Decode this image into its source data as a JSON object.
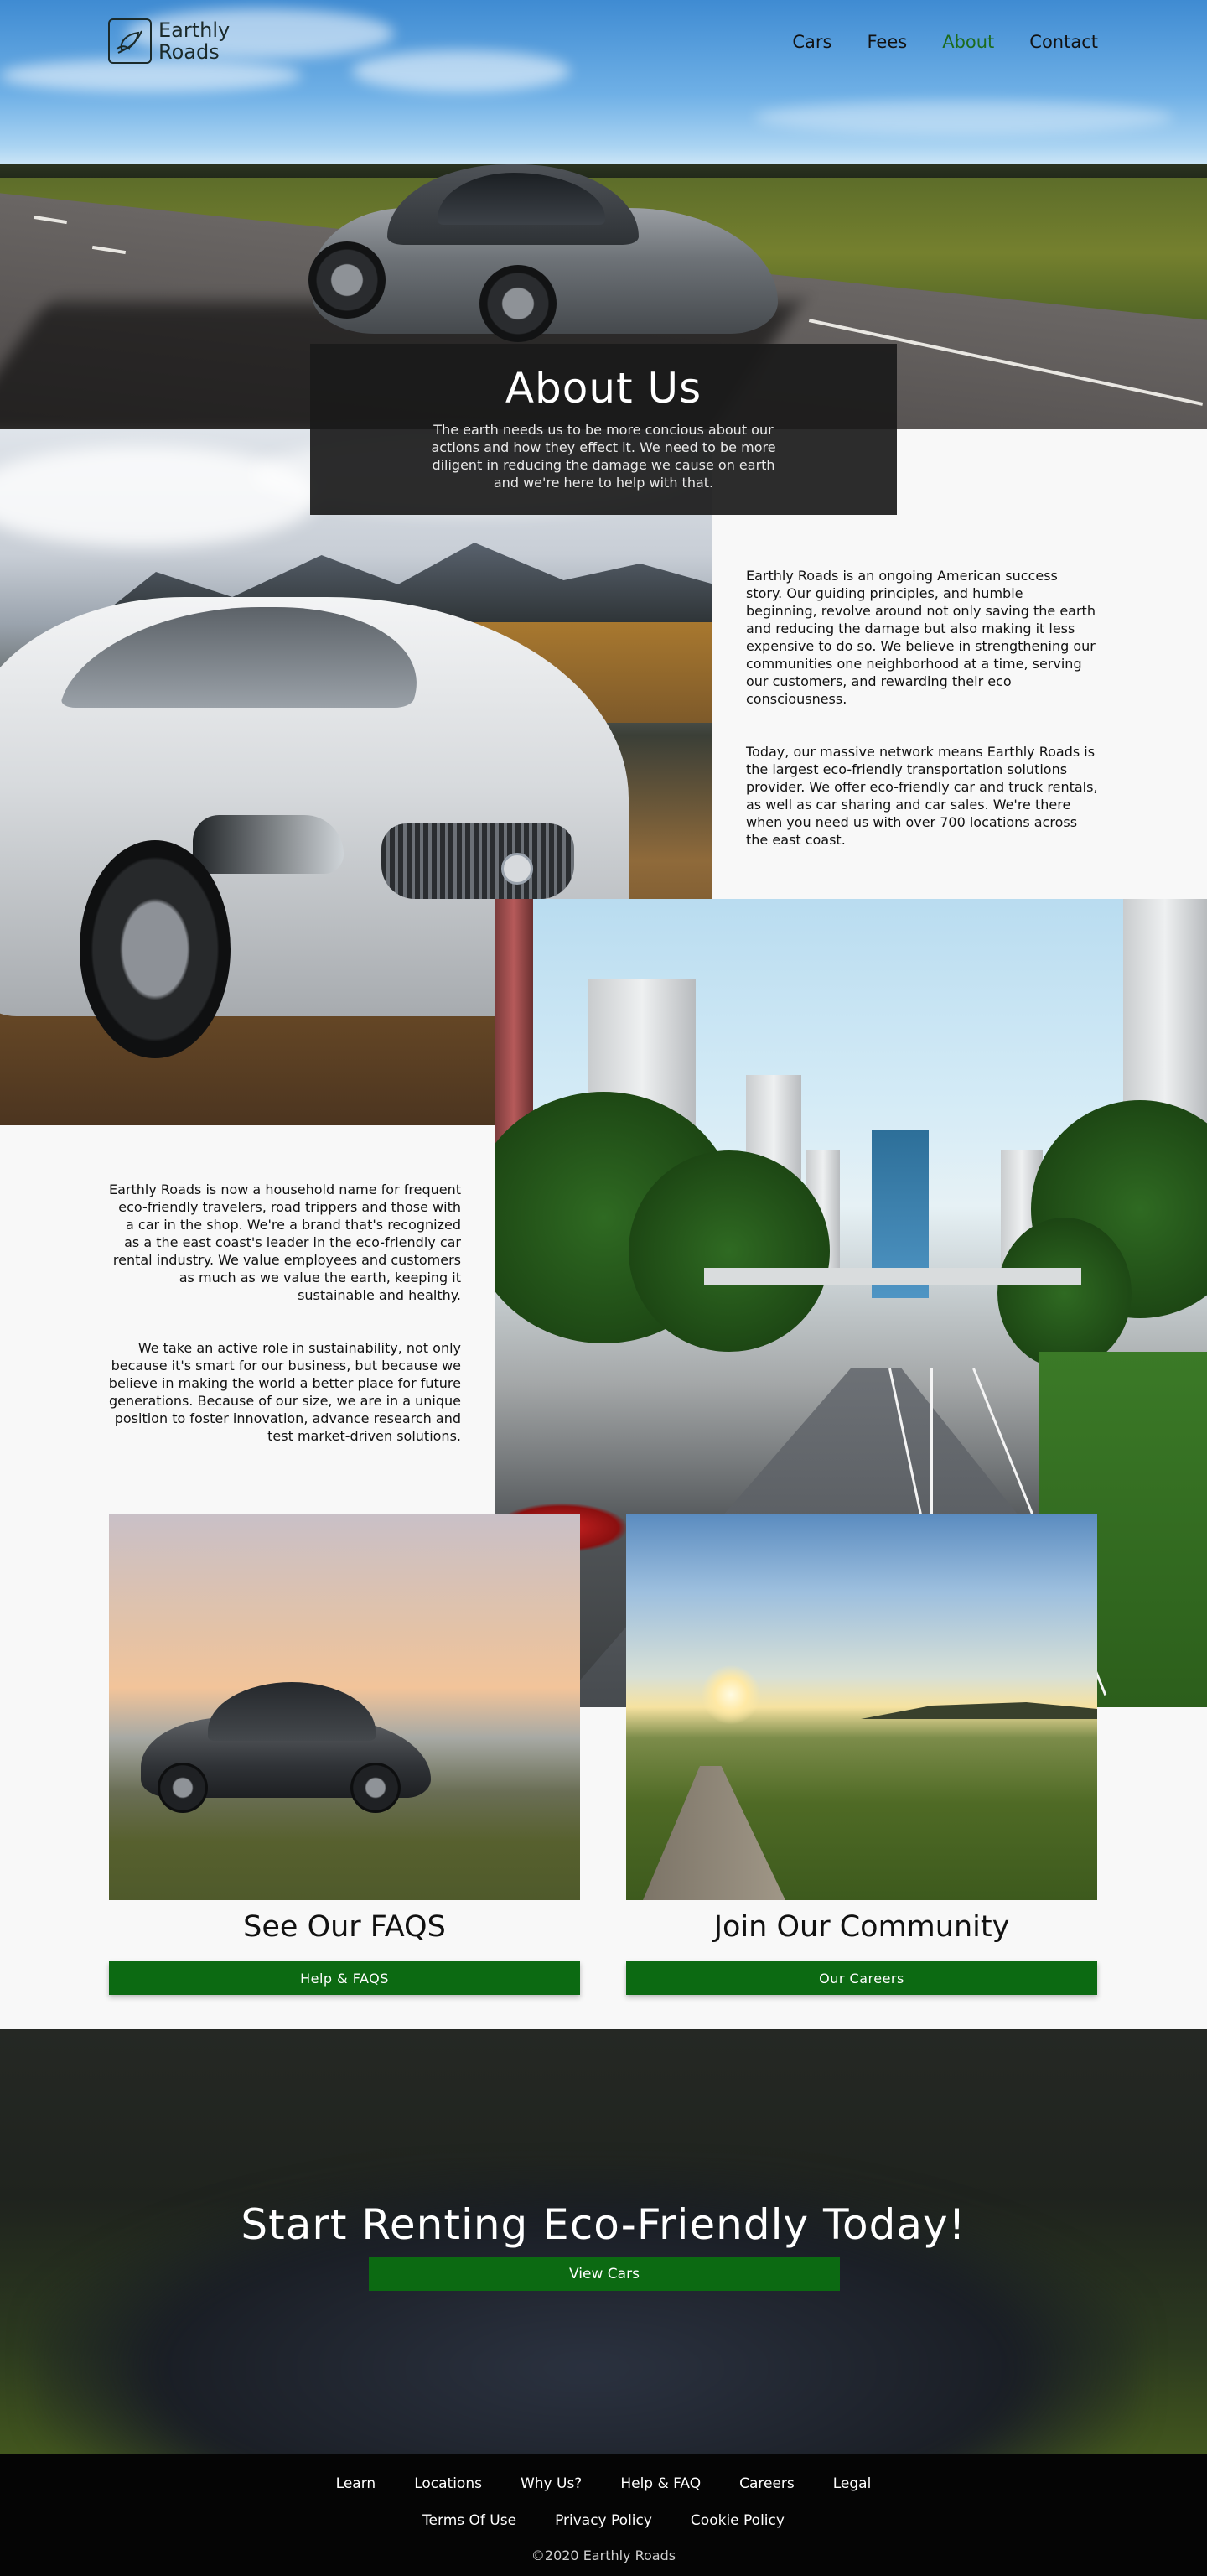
{
  "brand": {
    "line1": "Earthly",
    "line2": "Roads",
    "logo_icon": "leaf-icon"
  },
  "nav": [
    {
      "label": "Cars",
      "active": false
    },
    {
      "label": "Fees",
      "active": false
    },
    {
      "label": "About",
      "active": true
    },
    {
      "label": "Contact",
      "active": false
    }
  ],
  "hero": {
    "title": "About Us",
    "text": "The earth needs us to be more concious about our actions and how they effect it. We need to be more diligent in reducing the damage we cause on earth and we're here to help with that."
  },
  "story": {
    "p1": "Earthly Roads is an ongoing American success story. Our guiding principles, and humble beginning, revolve around not only saving the earth and reducing the damage but also making it less expensive to do so. We believe in strengthening our communities one neighborhood at a time, serving our customers, and rewarding their eco consciousness.",
    "p2": "Today, our massive network means Earthly Roads is the largest eco-friendly transportation solutions provider. We offer eco-friendly car and truck rentals, as well as car sharing and car sales. We're there when you need us with over 700 locations across the east coast.",
    "p3": "Earthly Roads is now a household name for frequent eco-friendly travelers, road trippers and those with a car in the shop. We're a brand that's recognized as a the east coast's leader in the eco-friendly car rental industry. We value employees and customers as much as we value the earth, keeping it sustainable and healthy.",
    "p4": "We take an active role in sustainability, not only because it's smart for our business, but because we believe in making the world a better place for future generations. Because of our size, we are in a unique position to foster innovation, advance research and test market-driven solutions."
  },
  "cards": [
    {
      "title": "See Our FAQS",
      "button": "Help & FAQS"
    },
    {
      "title": "Join Our Community",
      "button": "Our Careers"
    }
  ],
  "cta": {
    "title": "Start Renting Eco-Friendly Today!",
    "button": "View Cars"
  },
  "footer": {
    "row1": [
      "Learn",
      "Locations",
      "Why Us?",
      "Help & FAQ",
      "Careers",
      "Legal"
    ],
    "row2": [
      "Terms Of Use",
      "Privacy Policy",
      "Cookie Policy"
    ],
    "copyright": "©2020 Earthly Roads"
  },
  "colors": {
    "accent": "#0c6a12",
    "nav_active": "#1d6b1d",
    "footer_bg": "#050505"
  }
}
